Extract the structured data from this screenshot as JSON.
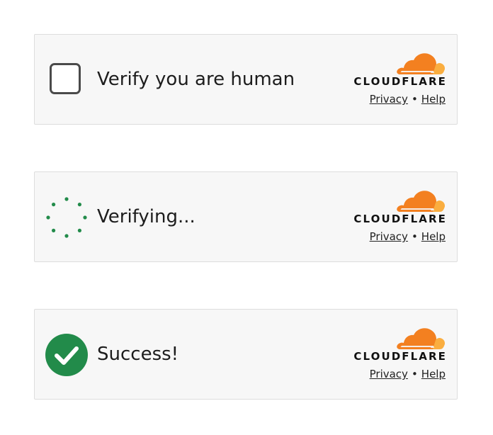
{
  "colors": {
    "widget_background": "#f7f7f7",
    "widget_border": "#dddddd",
    "success_green": "#228b4a",
    "cloudflare_orange": "#f38020",
    "cloudflare_light_orange": "#faae40",
    "text": "#1d1d1d"
  },
  "widgets": [
    {
      "state": "unchecked",
      "icon": "checkbox-icon",
      "label": "Verify you are human",
      "brand": "CLOUDFLARE",
      "privacy_link": "Privacy",
      "separator": "•",
      "help_link": "Help"
    },
    {
      "state": "verifying",
      "icon": "spinner-icon",
      "label": "Verifying...",
      "brand": "CLOUDFLARE",
      "privacy_link": "Privacy",
      "separator": "•",
      "help_link": "Help"
    },
    {
      "state": "success",
      "icon": "success-check-icon",
      "label": "Success!",
      "brand": "CLOUDFLARE",
      "privacy_link": "Privacy",
      "separator": "•",
      "help_link": "Help"
    }
  ]
}
